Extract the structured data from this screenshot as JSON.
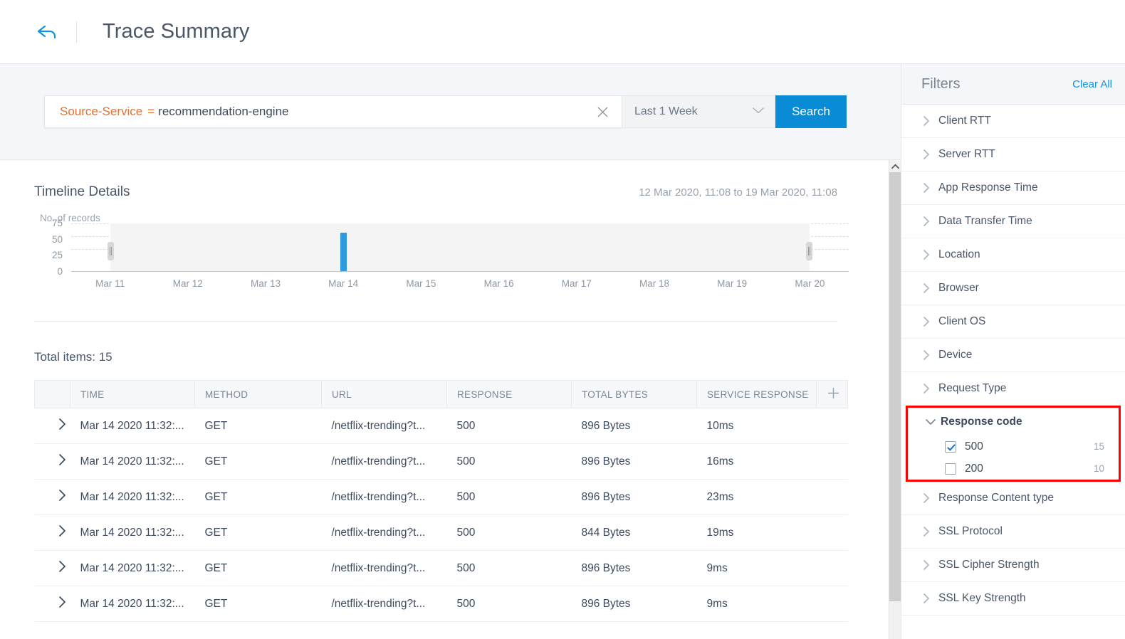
{
  "header": {
    "back_icon": "back-arrow-icon",
    "title": "Trace Summary"
  },
  "search": {
    "query_key": "Source-Service",
    "query_operator": "=",
    "query_value": "recommendation-engine",
    "clear_icon": "close-icon",
    "time_range": "Last 1 Week",
    "dropdown_icon": "chevron-down-icon",
    "search_button": "Search"
  },
  "timeline": {
    "title": "Timeline Details",
    "range_text": "12 Mar 2020, 11:08 to 19 Mar 2020, 11:08"
  },
  "chart_data": {
    "type": "bar",
    "title": "Timeline Details",
    "ylabel": "No. of records",
    "xlabel": "",
    "ylim": [
      0,
      75
    ],
    "yticks": [
      0,
      25,
      50,
      75
    ],
    "grid": true,
    "legend": "none",
    "categories": [
      "Mar 11",
      "Mar 12",
      "Mar 13",
      "Mar 14",
      "Mar 15",
      "Mar 16",
      "Mar 17",
      "Mar 18",
      "Mar 19",
      "Mar 20"
    ],
    "values": [
      0,
      0,
      0,
      60,
      0,
      0,
      0,
      0,
      0,
      0
    ],
    "bar_color": "#2b9ae0",
    "brush_selection": {
      "start": "Mar 11 (mid)",
      "end": "Mar 20 (mid)"
    }
  },
  "table": {
    "total_items_label": "Total items: 15",
    "add_column_icon": "plus-icon",
    "expand_icon": "chevron-right-icon",
    "columns": [
      "",
      "TIME",
      "METHOD",
      "URL",
      "RESPONSE",
      "TOTAL BYTES",
      "SERVICE RESPONSE",
      ""
    ],
    "rows": [
      {
        "time": "Mar 14 2020 11:32:...",
        "method": "GET",
        "url": "/netflix-trending?t...",
        "response": "500",
        "bytes": "896 Bytes",
        "service_response": "10ms"
      },
      {
        "time": "Mar 14 2020 11:32:...",
        "method": "GET",
        "url": "/netflix-trending?t...",
        "response": "500",
        "bytes": "896 Bytes",
        "service_response": "16ms"
      },
      {
        "time": "Mar 14 2020 11:32:...",
        "method": "GET",
        "url": "/netflix-trending?t...",
        "response": "500",
        "bytes": "896 Bytes",
        "service_response": "23ms"
      },
      {
        "time": "Mar 14 2020 11:32:...",
        "method": "GET",
        "url": "/netflix-trending?t...",
        "response": "500",
        "bytes": "844 Bytes",
        "service_response": "19ms"
      },
      {
        "time": "Mar 14 2020 11:32:...",
        "method": "GET",
        "url": "/netflix-trending?t...",
        "response": "500",
        "bytes": "896 Bytes",
        "service_response": "9ms"
      },
      {
        "time": "Mar 14 2020 11:32:...",
        "method": "GET",
        "url": "/netflix-trending?t...",
        "response": "500",
        "bytes": "896 Bytes",
        "service_response": "9ms"
      }
    ]
  },
  "filters": {
    "title": "Filters",
    "clear_all": "Clear All",
    "items_before": [
      "Client RTT",
      "Server RTT",
      "App Response Time",
      "Data Transfer Time",
      "Location",
      "Browser",
      "Client OS",
      "Device",
      "Request Type"
    ],
    "response_code": {
      "label": "Response code",
      "expanded": true,
      "highlight_color": "#ff0000",
      "options": [
        {
          "name": "500",
          "count": "15",
          "checked": true
        },
        {
          "name": "200",
          "count": "10",
          "checked": false
        }
      ]
    },
    "items_after": [
      "Response Content type",
      "SSL Protocol",
      "SSL Cipher Strength",
      "SSL Key Strength"
    ]
  },
  "scrollbar": {
    "up_arrow_icon": "chevron-up-icon"
  }
}
